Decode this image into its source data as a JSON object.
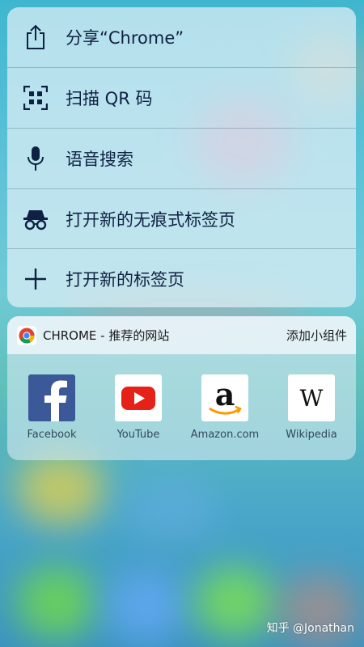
{
  "menu": {
    "items": [
      {
        "label": "分享“Chrome”",
        "icon": "share-icon"
      },
      {
        "label": "扫描 QR 码",
        "icon": "qr-scan-icon"
      },
      {
        "label": "语音搜索",
        "icon": "microphone-icon"
      },
      {
        "label": "打开新的无痕式标签页",
        "icon": "incognito-icon"
      },
      {
        "label": "打开新的标签页",
        "icon": "plus-icon"
      }
    ]
  },
  "widget": {
    "title": "CHROME - 推荐的网站",
    "action": "添加小组件",
    "logo": "chrome-logo-icon",
    "sites": [
      {
        "label": "Facebook",
        "icon": "facebook-icon",
        "color": "#3b5998"
      },
      {
        "label": "YouTube",
        "icon": "youtube-icon",
        "color": "#e62117"
      },
      {
        "label": "Amazon.com",
        "icon": "amazon-icon",
        "color": "#ff9900"
      },
      {
        "label": "Wikipedia",
        "icon": "wikipedia-icon",
        "color": "#000000"
      }
    ]
  },
  "watermark": "知乎 @Jonathan",
  "colors": {
    "menu_text": "#0f2142",
    "background": "#5cc2d8"
  }
}
